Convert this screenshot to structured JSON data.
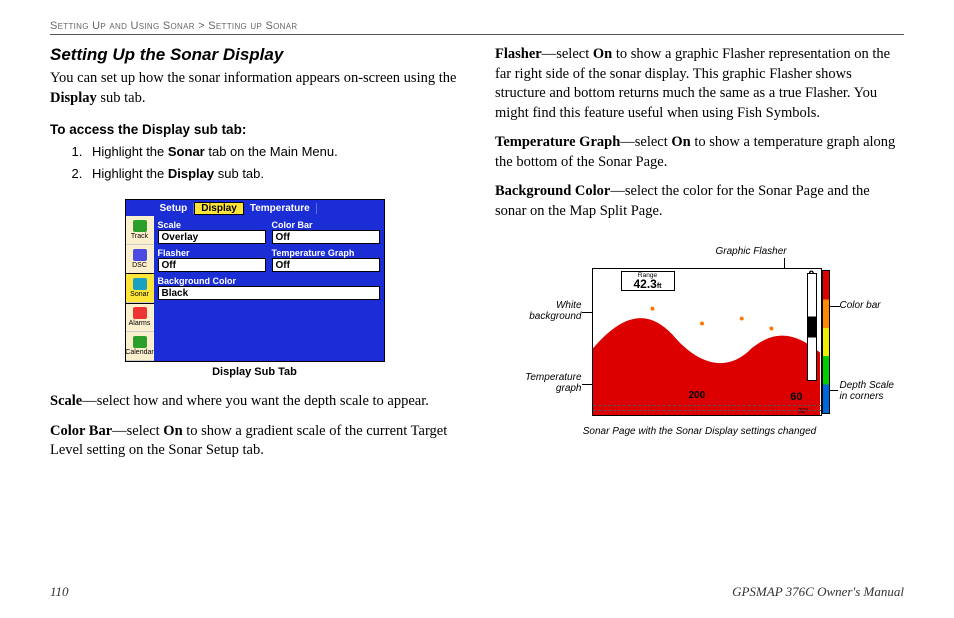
{
  "breadcrumb": {
    "section": "Setting Up and Using Sonar",
    "sep": ">",
    "sub": "Setting up Sonar"
  },
  "left": {
    "title": "Setting Up the Sonar Display",
    "intro_a": "You can set up how the sonar information appears on-screen using the ",
    "intro_b": "Display",
    "intro_c": " sub tab.",
    "access_head": "To access the Display sub tab:",
    "steps": [
      {
        "pre": "Highlight the ",
        "bold": "Sonar",
        "post": " tab on the Main Menu."
      },
      {
        "pre": "Highlight the ",
        "bold": "Display",
        "post": " sub tab."
      }
    ],
    "caption1": "Display Sub Tab",
    "scale": {
      "term": "Scale",
      "text": "—select how and where you want the depth scale to appear."
    },
    "colorbar": {
      "term": "Color Bar",
      "on": "On",
      "text_a": "—select ",
      "text_b": " to show a gradient scale of the current Target Level setting on the Sonar Setup tab."
    }
  },
  "right": {
    "flasher": {
      "term": "Flasher",
      "on": "On",
      "text_a": "—select ",
      "text_b": " to show a graphic Flasher representation on the far right side of the sonar display. This graphic Flasher shows structure and bottom returns much the same as a true Flasher. You might find this feature useful when using Fish Symbols."
    },
    "tgraph": {
      "term": "Temperature Graph",
      "on": "On",
      "text_a": "—select ",
      "text_b": " to show a temperature graph along the bottom of the Sonar Page."
    },
    "bgcolor": {
      "term": "Background Color",
      "text": "—select the color for the Sonar Page and the sonar on the Map Split Page."
    },
    "fig_caption": "Sonar Page with the Sonar Display settings changed",
    "ann": {
      "graphic_flasher": "Graphic Flasher",
      "white_bg_l1": "White",
      "white_bg_l2": "background",
      "color_bar": "Color bar",
      "temp_l1": "Temperature",
      "temp_l2": "graph",
      "depth_l1": "Depth Scale",
      "depth_l2": "in corners"
    }
  },
  "device": {
    "tabs": [
      "Setup",
      "Display",
      "Temperature"
    ],
    "sidebar": [
      {
        "label": "Track",
        "color": "#2aa02a"
      },
      {
        "label": "DSC",
        "color": "#4a4ae0"
      },
      {
        "label": "Sonar",
        "color": "#1aa0c0"
      },
      {
        "label": "Alarms",
        "color": "#e33"
      },
      {
        "label": "Calendar",
        "color": "#2aa02a"
      }
    ],
    "rows": {
      "scale_label": "Scale",
      "scale_value": "Overlay",
      "cbar_label": "Color Bar",
      "cbar_value": "Off",
      "flash_label": "Flasher",
      "flash_value": "Off",
      "tg_label": "Temperature Graph",
      "tg_value": "Off",
      "bg_label": "Background Color",
      "bg_value": "Black"
    }
  },
  "sonar_readout": {
    "range_label": "Range",
    "depth": "42.3",
    "depth_unit": "ft",
    "corner_top": "0",
    "corner_mid": "200",
    "temp": "60",
    "temp_floor": "32°"
  },
  "footer": {
    "page": "110",
    "manual": "GPSMAP 376C Owner's Manual"
  }
}
